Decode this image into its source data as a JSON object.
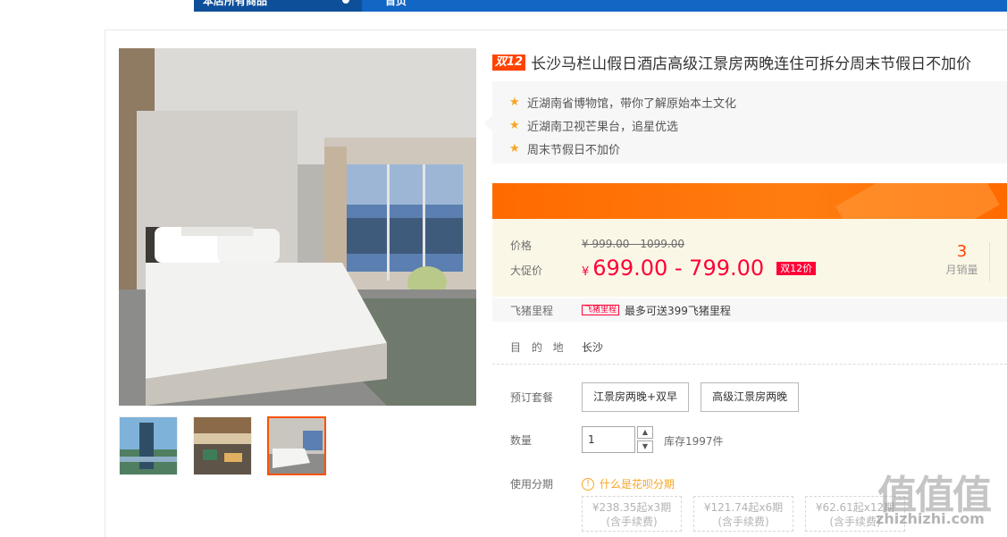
{
  "topnav": {
    "category_label": "本店所有商品",
    "home_label": "首页"
  },
  "product": {
    "promo_badge": "双12",
    "title": "长沙马栏山假日酒店高级江景房两晚连住可拆分周末节假日不加价",
    "features": [
      "近湖南省博物馆，带你了解原始本土文化",
      "近湖南卫视芒果台，追星优选",
      "周末节假日不加价"
    ],
    "price_label": "价格",
    "original_price": "¥ 999.00 - 1099.00",
    "promo_label": "大促价",
    "currency": "¥",
    "promo_price": "699.00 - 799.00",
    "promo_tag": "双12价",
    "monthly_sales_count": "3",
    "monthly_sales_label": "月销量",
    "miles_label": "飞猪里程",
    "miles_tag": "飞猪里程",
    "miles_text": "最多可送399飞猪里程",
    "destination_label": "目 的 地",
    "destination_value": "长沙",
    "package_label": "预订套餐",
    "packages": [
      "江景房两晚+双早",
      "高级江景房两晚"
    ],
    "quantity_label": "数量",
    "quantity_value": "1",
    "stock_text": "库存1997件",
    "installment_label": "使用分期",
    "installment_help": "什么是花呗分期",
    "installment_plans": [
      {
        "line1": "¥238.35起x3期",
        "line2": "(含手续费)"
      },
      {
        "line1": "¥121.74起x6期",
        "line2": "(含手续费)"
      },
      {
        "line1": "¥62.61起x12期",
        "line2": "(含手续费)"
      }
    ]
  },
  "watermark": {
    "glyphs": "值值值",
    "site": "zhizhizhi.com"
  },
  "colors": {
    "accent": "#ff5000",
    "price_red": "#ff0036",
    "nav_blue": "#1266c4",
    "star": "#f6a623"
  },
  "icons": {
    "feature": "star-icon",
    "help": "question-circle-icon",
    "step_up": "chevron-up-icon",
    "step_down": "chevron-down-icon"
  }
}
